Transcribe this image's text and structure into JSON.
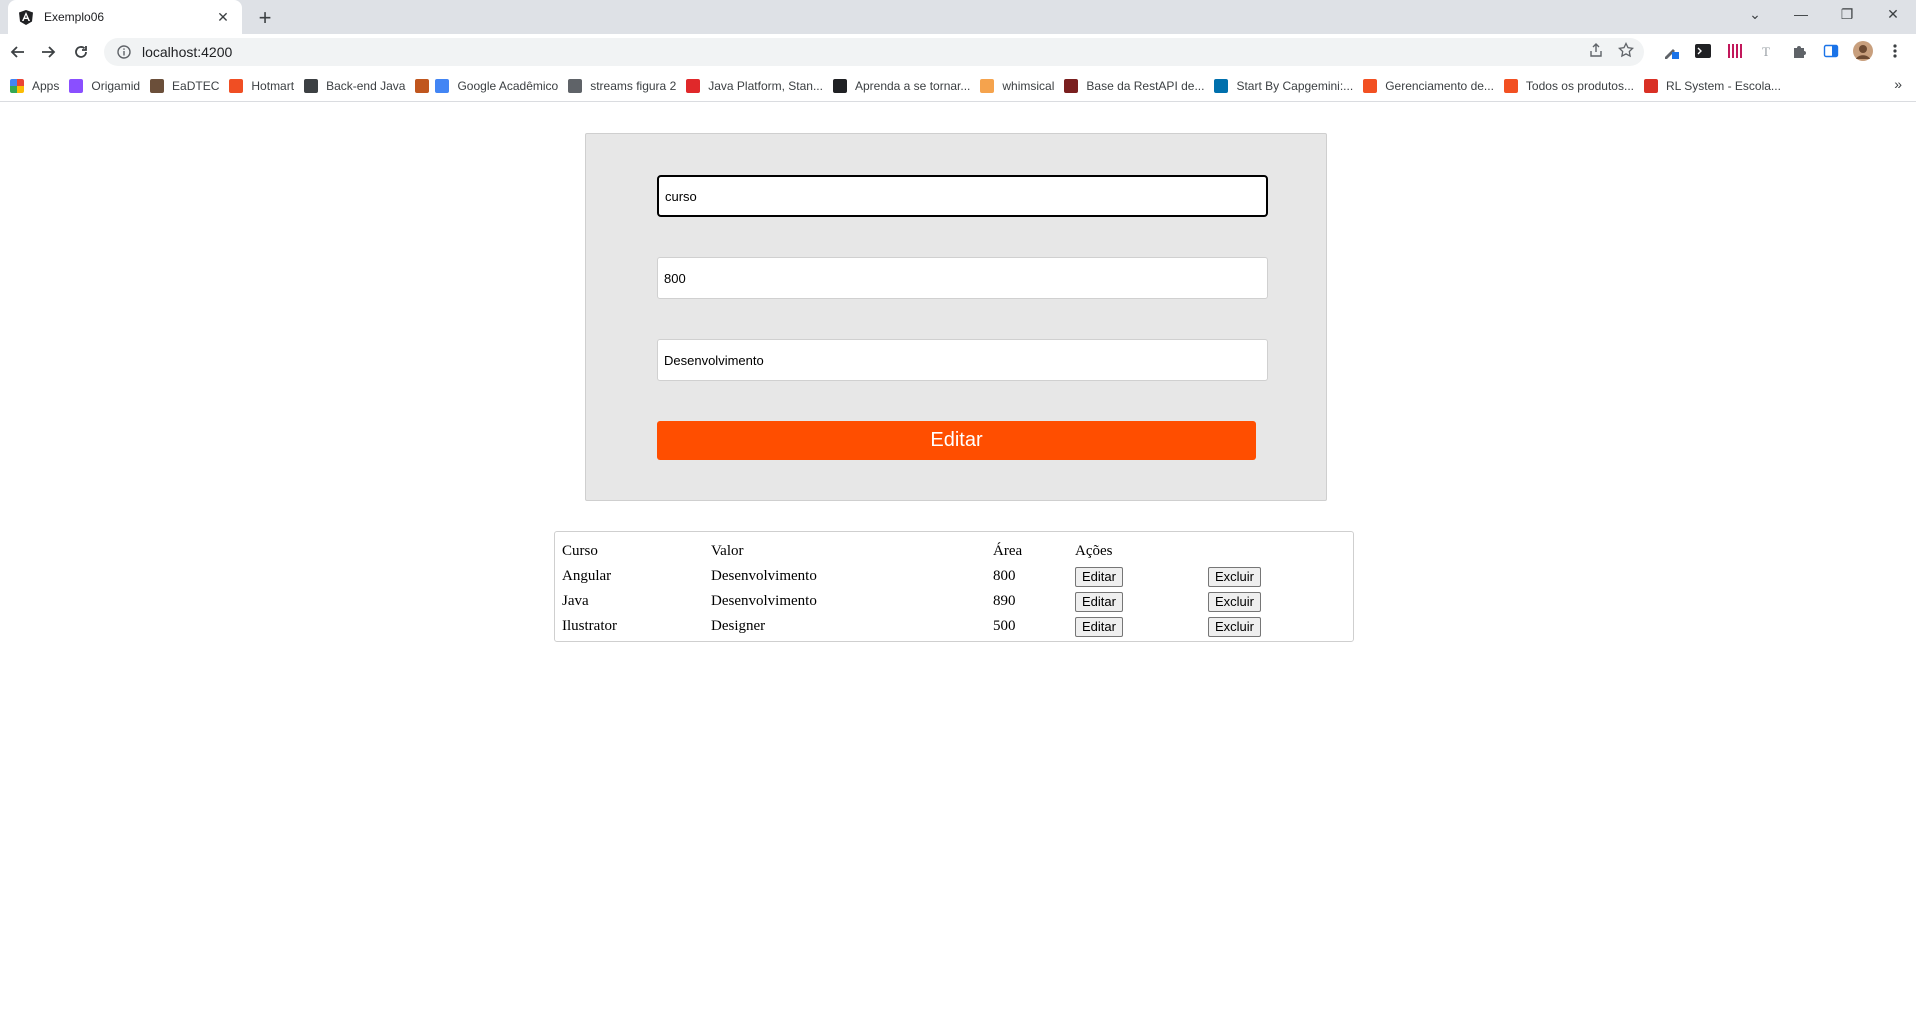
{
  "browser": {
    "tab_title": "Exemplo06",
    "url": "localhost:4200",
    "bookmarks": [
      {
        "label": "Apps",
        "icon": "apps-grid-icon",
        "color": "#ea4335"
      },
      {
        "label": "Origamid",
        "icon": "origamid-icon",
        "color": "#8a4fff"
      },
      {
        "label": "EaDTEC",
        "icon": "eadtec-icon",
        "color": "#6b4f3a"
      },
      {
        "label": "Hotmart",
        "icon": "hotmart-icon",
        "color": "#f04e23"
      },
      {
        "label": "Back-end Java",
        "icon": "contact-card-icon",
        "color": "#3c4043"
      },
      {
        "label": "",
        "icon": "butterfly-icon",
        "color": "#c0561e"
      },
      {
        "label": "Google Acadêmico",
        "icon": "scholar-cap-icon",
        "color": "#4285f4"
      },
      {
        "label": "streams figura 2",
        "icon": "globe-icon",
        "color": "#5f6368"
      },
      {
        "label": "Java Platform, Stan...",
        "icon": "oracle-icon",
        "color": "#e0282a"
      },
      {
        "label": "Aprenda a se tornar...",
        "icon": "r-square-icon",
        "color": "#202124"
      },
      {
        "label": "whimsical",
        "icon": "whimsical-icon",
        "color": "#f5a34d"
      },
      {
        "label": "Base da RestAPI de...",
        "icon": "restapi-icon",
        "color": "#7a1f1f"
      },
      {
        "label": "Start By Capgemini:...",
        "icon": "capgemini-icon",
        "color": "#0070ad"
      },
      {
        "label": "Gerenciamento de...",
        "icon": "microsoft-icon",
        "color": "#f25022"
      },
      {
        "label": "Todos os produtos...",
        "icon": "microsoft-icon",
        "color": "#f25022"
      },
      {
        "label": "RL System - Escola...",
        "icon": "rls-icon",
        "color": "#d93025"
      }
    ]
  },
  "form": {
    "course_value": "curso",
    "price_value": "800",
    "area_value": "Desenvolvimento",
    "submit_label": "Editar"
  },
  "table": {
    "headers": [
      "Curso",
      "Valor",
      "Área",
      "Ações"
    ],
    "rows": [
      {
        "curso": "Angular",
        "valor": "Desenvolvimento",
        "area": "800",
        "edit": "Editar",
        "delete": "Excluir"
      },
      {
        "curso": "Java",
        "valor": "Desenvolvimento",
        "area": "890",
        "edit": "Editar",
        "delete": "Excluir"
      },
      {
        "curso": "Ilustrator",
        "valor": "Designer",
        "area": "500",
        "edit": "Editar",
        "delete": "Excluir"
      }
    ]
  },
  "colors": {
    "accent": "#ff4e00",
    "card_bg": "#e7e7e7"
  }
}
